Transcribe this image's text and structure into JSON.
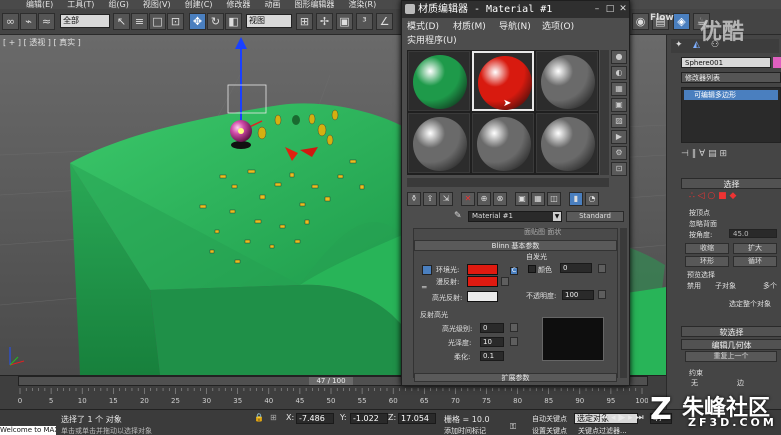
{
  "menubar": {
    "items": [
      "编辑(E)",
      "工具(T)",
      "组(G)",
      "视图(V)",
      "创建(C)",
      "修改器",
      "动画",
      "图形编辑器",
      "渲染(R)"
    ]
  },
  "toolbar": {
    "selection_filter": "全部",
    "ref_coord": "视图"
  },
  "viewport": {
    "label": "[ + ] [ 透视 ] [ 真实 ]"
  },
  "timeline": {
    "frame_readout": "47 / 100",
    "ruler_ticks": [
      "0",
      "5",
      "10",
      "15",
      "20",
      "25",
      "30",
      "35",
      "40",
      "45",
      "50",
      "55",
      "60",
      "65",
      "70",
      "75",
      "80",
      "85",
      "90",
      "95",
      "100"
    ]
  },
  "status": {
    "maxscript": "Welcome to MAXScript.",
    "selection_text": "选择了 1 个 对象",
    "hint_text": "单击或单击并拖动以选择对象",
    "x_label": "X:",
    "x_value": "-7.486",
    "y_label": "Y:",
    "y_value": "-1.022",
    "z_label": "Z:",
    "z_value": "17.054",
    "grid_text": "栅格 = 10.0",
    "add_time_tag": "添加时间标记",
    "auto_key": "自动关键点",
    "set_key": "设置关键点",
    "selected_dropdown": "选定对象",
    "key_filter": "关键点过滤器...",
    "frame_value": "47"
  },
  "command_panel": {
    "object_name": "Sphere001",
    "modifier_list": "修改器列表",
    "stack_item": "可编辑多边形",
    "selection_header": "选择",
    "by_vertex": "按顶点",
    "ignore_backfacing": "忽略背面",
    "by_angle": "按角度:",
    "angle_value": "45.0",
    "shrink": "收缩",
    "grow": "扩大",
    "ring": "环形",
    "loop": "循环",
    "preview_selection": "预览选择",
    "disabled": "禁用",
    "subobject": "子对象",
    "multi": "多个",
    "whole_object_selected": "选定整个对象",
    "soft_selection": "软选择",
    "edit_geometry": "编辑几何体",
    "repeat_last": "重复上一个",
    "constraints": "约束",
    "none": "无",
    "edge": "边"
  },
  "material_editor": {
    "title": "材质编辑器 - Material #1",
    "menu": [
      "模式(D)",
      "材质(M)",
      "导航(N)",
      "选项(O)",
      "实用程序(U)"
    ],
    "material_name": "Material #1",
    "material_type": "Standard",
    "shader_rollout_fragment": "面贴图      面状",
    "blinn_header": "Blinn 基本参数",
    "self_illum": "自发光",
    "color_label": "颜色",
    "color_value": "0",
    "ambient_label": "环境光:",
    "diffuse_label": "漫反射:",
    "specular_label": "高光反射:",
    "opacity_label": "不透明度:",
    "opacity_value": "100",
    "spec_highlights": "反射高光",
    "spec_level_label": "高光级别:",
    "spec_level_value": "0",
    "gloss_label": "光泽度:",
    "gloss_value": "10",
    "soften_label": "柔化:",
    "soften_value": "0.1",
    "extended_params": "扩展参数",
    "slot_colors": [
      "#1e9a4a",
      "#d81a0f",
      "#6a6a6a",
      "#6a6a6a",
      "#6a6a6a",
      "#6a6a6a"
    ],
    "ambient_color": "#e01a10",
    "diffuse_color": "#e01a10",
    "specular_color": "#ececec"
  },
  "watermarks": {
    "youku": "优酷",
    "site_cn": "朱峰社区",
    "site_url": "ZF3D.COM",
    "flow_text": "Flow"
  },
  "colors": {
    "accent_blue": "#4a7fbf",
    "ground_green": "#2fb85a"
  }
}
